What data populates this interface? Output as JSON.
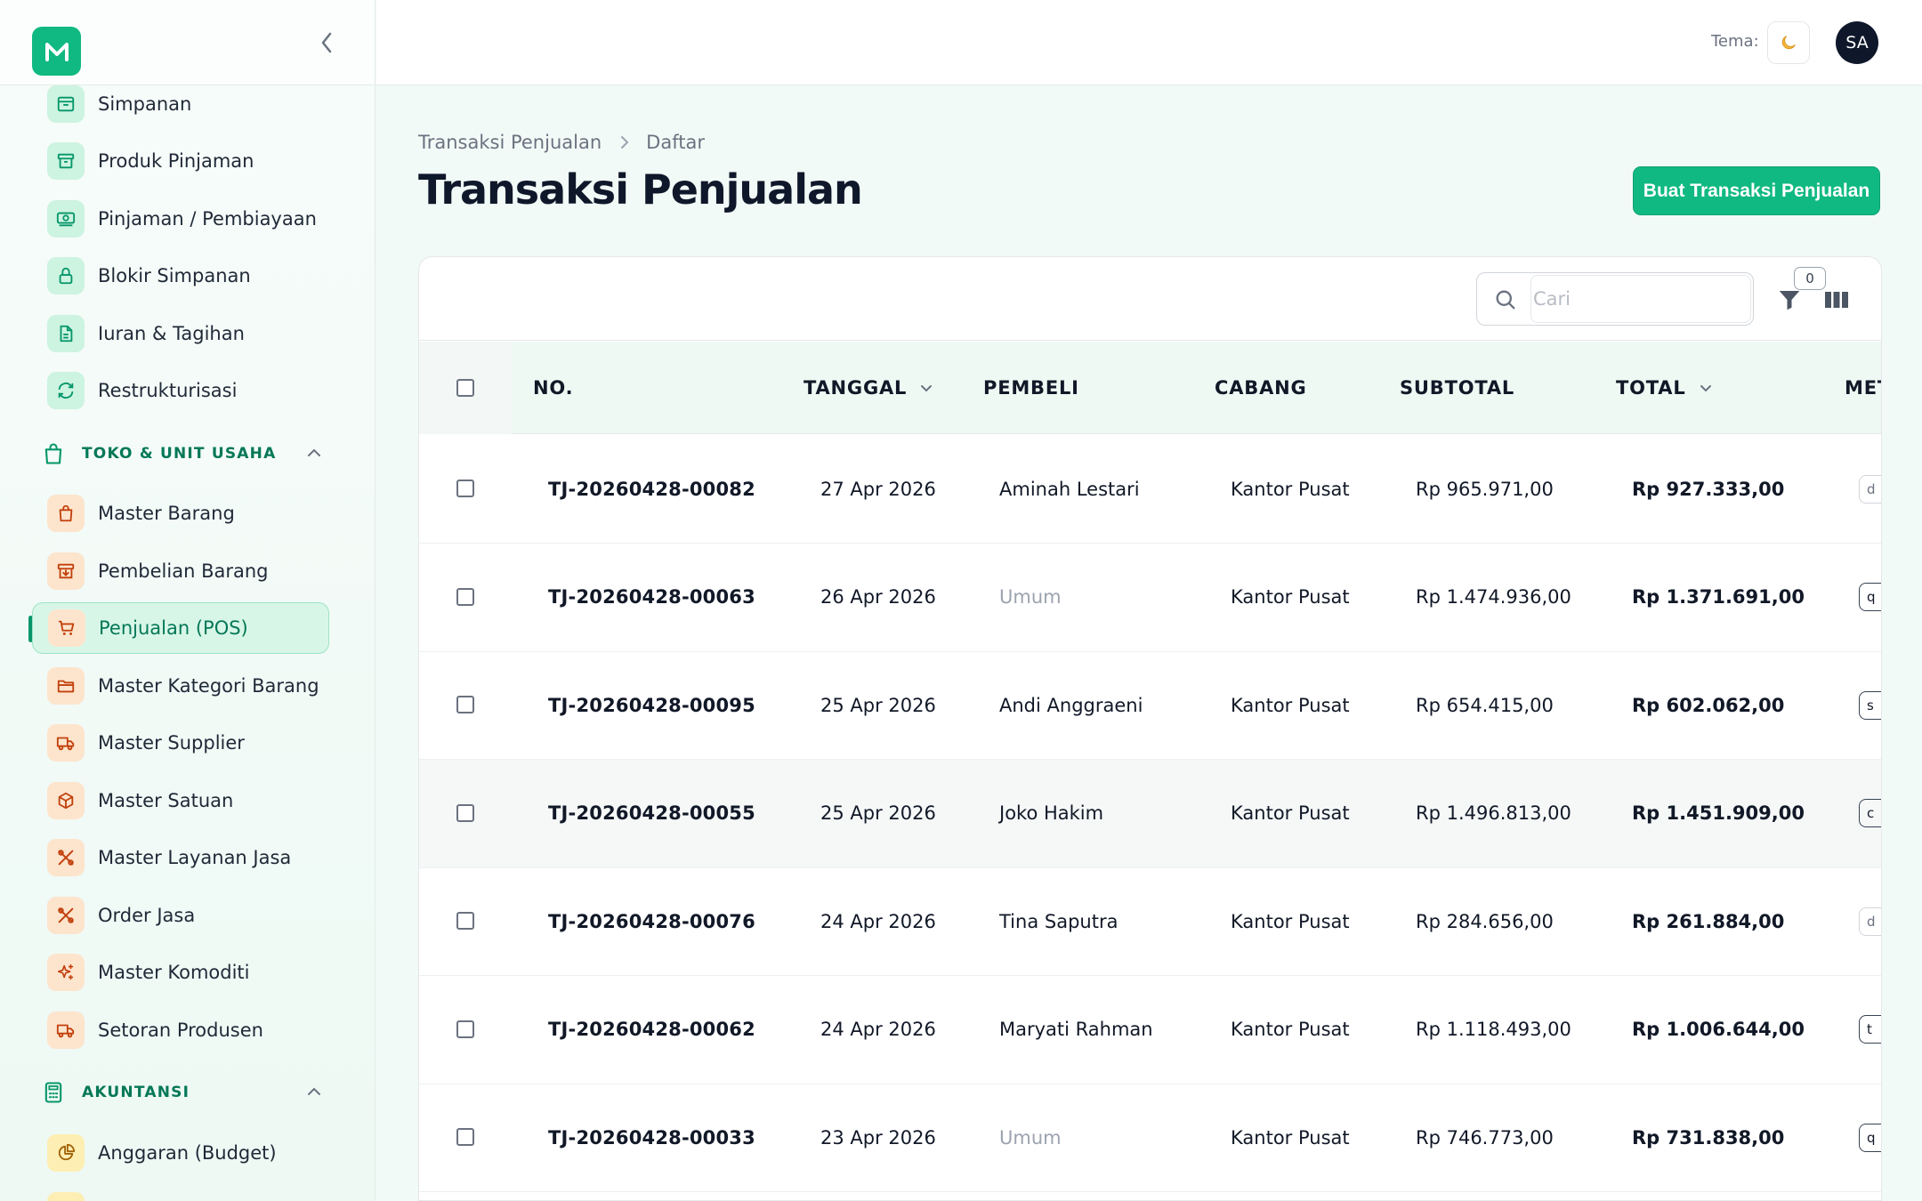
{
  "sidebar": {
    "items_top": [
      {
        "label": "Simpanan",
        "icon": "archive-icon",
        "color": "green"
      },
      {
        "label": "Produk Pinjaman",
        "icon": "box-icon",
        "color": "green"
      },
      {
        "label": "Pinjaman / Pembiayaan",
        "icon": "money-icon",
        "color": "green"
      },
      {
        "label": "Blokir Simpanan",
        "icon": "lock-icon",
        "color": "green"
      },
      {
        "label": "Iuran & Tagihan",
        "icon": "document-icon",
        "color": "green"
      },
      {
        "label": "Restrukturisasi",
        "icon": "refresh-icon",
        "color": "green"
      }
    ],
    "section_toko": "TOKO & UNIT USAHA",
    "items_toko": [
      {
        "label": "Master Barang",
        "icon": "shopping-bag-icon"
      },
      {
        "label": "Pembelian Barang",
        "icon": "inbox-download-icon"
      },
      {
        "label": "Penjualan (POS)",
        "icon": "cart-icon",
        "active": true
      },
      {
        "label": "Master Kategori Barang",
        "icon": "folder-icon"
      },
      {
        "label": "Master Supplier",
        "icon": "truck-icon"
      },
      {
        "label": "Master Satuan",
        "icon": "cube-icon"
      },
      {
        "label": "Master Layanan Jasa",
        "icon": "tools-icon"
      },
      {
        "label": "Order Jasa",
        "icon": "tools-icon"
      },
      {
        "label": "Master Komoditi",
        "icon": "sparkle-icon"
      },
      {
        "label": "Setoran Produsen",
        "icon": "truck-icon"
      }
    ],
    "section_akuntansi": "AKUNTANSI",
    "items_akuntansi": [
      {
        "label": "Anggaran (Budget)",
        "icon": "pie-chart-icon"
      }
    ]
  },
  "topbar": {
    "theme_label": "Tema:",
    "theme_icon": "moon-icon",
    "avatar_initials": "SA"
  },
  "breadcrumb": {
    "parent": "Transaksi Penjualan",
    "current": "Daftar"
  },
  "page": {
    "title": "Transaksi Penjualan",
    "create_button": "Buat Transaksi Penjualan"
  },
  "toolbar": {
    "search_placeholder": "Cari",
    "filter_count": "0"
  },
  "table": {
    "headers": {
      "no": "NO.",
      "tanggal": "TANGGAL",
      "pembeli": "PEMBELI",
      "cabang": "CABANG",
      "subtotal": "SUBTOTAL",
      "total": "TOTAL",
      "metode": "MET"
    },
    "rows": [
      {
        "no": "TJ-20260428-00082",
        "tanggal": "27 Apr 2026",
        "pembeli": "Aminah Lestari",
        "cabang": "Kantor Pusat",
        "subtotal": "Rp 965.971,00",
        "total": "Rp 927.333,00",
        "metode": "d",
        "muted": false,
        "soft": true
      },
      {
        "no": "TJ-20260428-00063",
        "tanggal": "26 Apr 2026",
        "pembeli": "Umum",
        "cabang": "Kantor Pusat",
        "subtotal": "Rp 1.474.936,00",
        "total": "Rp 1.371.691,00",
        "metode": "q",
        "muted": true,
        "soft": false
      },
      {
        "no": "TJ-20260428-00095",
        "tanggal": "25 Apr 2026",
        "pembeli": "Andi Anggraeni",
        "cabang": "Kantor Pusat",
        "subtotal": "Rp 654.415,00",
        "total": "Rp 602.062,00",
        "metode": "s",
        "muted": false,
        "soft": false
      },
      {
        "no": "TJ-20260428-00055",
        "tanggal": "25 Apr 2026",
        "pembeli": "Joko Hakim",
        "cabang": "Kantor Pusat",
        "subtotal": "Rp 1.496.813,00",
        "total": "Rp 1.451.909,00",
        "metode": "c",
        "muted": false,
        "soft": false
      },
      {
        "no": "TJ-20260428-00076",
        "tanggal": "24 Apr 2026",
        "pembeli": "Tina Saputra",
        "cabang": "Kantor Pusat",
        "subtotal": "Rp 284.656,00",
        "total": "Rp 261.884,00",
        "metode": "d",
        "muted": false,
        "soft": true
      },
      {
        "no": "TJ-20260428-00062",
        "tanggal": "24 Apr 2026",
        "pembeli": "Maryati Rahman",
        "cabang": "Kantor Pusat",
        "subtotal": "Rp 1.118.493,00",
        "total": "Rp 1.006.644,00",
        "metode": "t",
        "muted": false,
        "soft": false
      },
      {
        "no": "TJ-20260428-00033",
        "tanggal": "23 Apr 2026",
        "pembeli": "Umum",
        "cabang": "Kantor Pusat",
        "subtotal": "Rp 746.773,00",
        "total": "Rp 731.838,00",
        "metode": "q",
        "muted": true,
        "soft": false
      }
    ]
  },
  "colors": {
    "accent": "#10b981",
    "accent_dark": "#047857",
    "sidebar_bg": "#eef9f4",
    "table_header_bg": "#eef9f4",
    "green_icon_bg": "#cdf3e1",
    "orange_icon_bg": "#fde4cd",
    "orange_icon": "#c2410c"
  }
}
